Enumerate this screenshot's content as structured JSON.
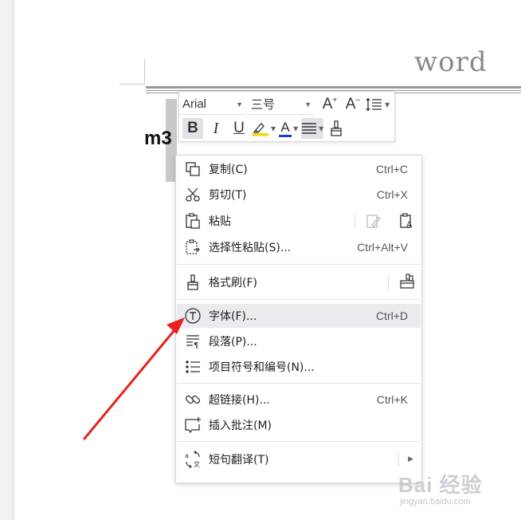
{
  "document": {
    "header_text": "word",
    "body_text": "m3"
  },
  "mini_toolbar": {
    "font_name": "Arial",
    "font_size": "三号",
    "grow_font_label": "A",
    "shrink_font_label": "A",
    "bold_label": "B",
    "italic_label": "I",
    "underline_label": "U",
    "font_color_label": "A",
    "highlight_color": "#f5d800",
    "font_color": "#1a3dd6",
    "active_state": [
      "bold",
      "align"
    ]
  },
  "context_menu": {
    "items": [
      {
        "label": "复制(C)",
        "shortcut": "Ctrl+C",
        "icon": "copy-icon"
      },
      {
        "label": "剪切(T)",
        "shortcut": "Ctrl+X",
        "icon": "cut-icon"
      },
      {
        "label": "粘贴",
        "shortcut": "",
        "icon": "paste-icon"
      },
      {
        "label": "选择性粘贴(S)...",
        "shortcut": "Ctrl+Alt+V",
        "icon": "paste-special-icon"
      },
      {
        "label": "格式刷(F)",
        "shortcut": "",
        "icon": "format-painter-icon"
      },
      {
        "label": "字体(F)...",
        "shortcut": "Ctrl+D",
        "icon": "font-icon",
        "highlighted": true
      },
      {
        "label": "段落(P)...",
        "shortcut": "",
        "icon": "paragraph-icon"
      },
      {
        "label": "项目符号和编号(N)...",
        "shortcut": "",
        "icon": "bullet-list-icon"
      },
      {
        "label": "超链接(H)...",
        "shortcut": "Ctrl+K",
        "icon": "hyperlink-icon"
      },
      {
        "label": "插入批注(M)",
        "shortcut": "",
        "icon": "comment-icon"
      },
      {
        "label": "短句翻译(T)",
        "shortcut": "",
        "icon": "translate-icon",
        "submenu": true
      }
    ]
  },
  "annotation": {
    "arrow_color": "#e8231f",
    "points_to": "字体(F)..."
  },
  "watermark": {
    "main": "Bai 经验",
    "sub": "jingyan.baidu.com"
  }
}
